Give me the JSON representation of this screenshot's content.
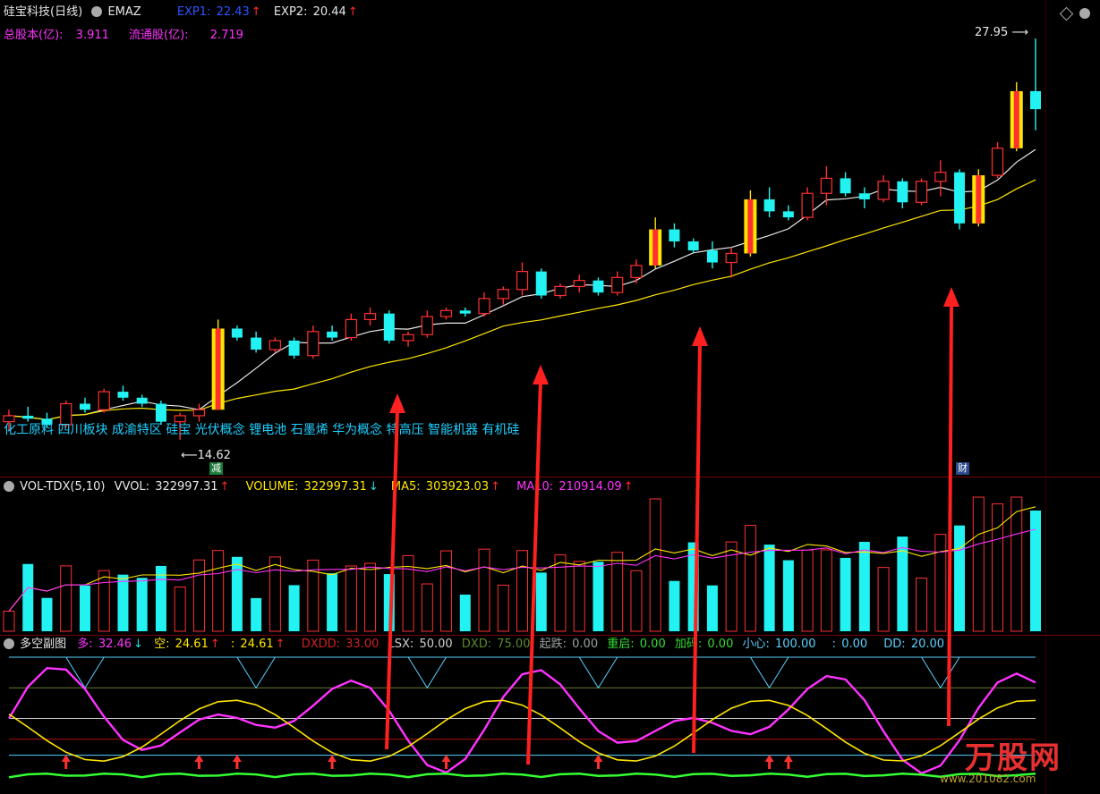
{
  "main_panel": {
    "stock_name": "硅宝科技(日线)",
    "indicator": "EMAZ",
    "exp1": {
      "label": "EXP1:",
      "value": "22.43",
      "arrow": "↑"
    },
    "exp2": {
      "label": "EXP2:",
      "value": "20.44",
      "arrow": "↑"
    },
    "total_share_label": "总股本(亿):",
    "total_share_value": "3.911",
    "float_share_label": "流通股(亿):",
    "float_share_value": "2.719",
    "high_label": "27.95",
    "low_label": "14.62",
    "concepts": "化工原料 四川板块 成渝特区 硅宝 光伏概念 锂电池 石墨烯 华为概念 特高压 智能机器 有机硅",
    "tag_jian": "减",
    "tag_cai": "财"
  },
  "volume_panel": {
    "name": "VOL-TDX(5,10)",
    "vvol": {
      "label": "VVOL:",
      "value": "322997.31",
      "arrow": "↑"
    },
    "volume": {
      "label": "VOLUME:",
      "value": "322997.31",
      "arrow": "↓"
    },
    "ma5": {
      "label": "MA5:",
      "value": "303923.03",
      "arrow": "↑"
    },
    "ma10": {
      "label": "MA10:",
      "value": "210914.09",
      "arrow": "↑"
    }
  },
  "sub_panel": {
    "name": "多空副图",
    "duo": {
      "label": "多:",
      "value": "32.46",
      "arrow": "↓"
    },
    "kong": {
      "label": "空:",
      "value": "24.61",
      "arrow": "↑"
    },
    "blank": {
      "label": ":",
      "value": "24.61",
      "arrow": "↑"
    },
    "dxdd": {
      "label": "DXDD:",
      "value": "33.00"
    },
    "lsx": {
      "label": "LSX:",
      "value": "50.00"
    },
    "dxd": {
      "label": "DXD:",
      "value": "75.00"
    },
    "qidie": {
      "label": "起跌:",
      "value": "0.00"
    },
    "chongqi": {
      "label": "重启:",
      "value": "0.00"
    },
    "jiama": {
      "label": "加码:",
      "value": "0.00"
    },
    "xiaoxin": {
      "label": "小心:",
      "value": "100.00"
    },
    "blank2": {
      "label": ":",
      "value": "0.00"
    },
    "dd": {
      "label": "DD:",
      "value": "20.00"
    }
  },
  "watermark": {
    "text": "万股网",
    "url": "www.201082.com"
  },
  "colors": {
    "up": "#ff3030",
    "down": "#22f2f2",
    "yellow": "#ffe600",
    "magenta": "#ff33ff",
    "white": "#e8e8e8",
    "green": "#33ff33"
  },
  "chart_data": {
    "type": "candlestick",
    "candles": [
      [
        15.2,
        15.6,
        14.9,
        15.4
      ],
      [
        15.4,
        15.7,
        15.2,
        15.3
      ],
      [
        15.3,
        15.5,
        15.0,
        15.1
      ],
      [
        15.1,
        15.9,
        15.0,
        15.8
      ],
      [
        15.8,
        16.0,
        15.5,
        15.6
      ],
      [
        15.6,
        16.3,
        15.5,
        16.2
      ],
      [
        16.2,
        16.4,
        15.9,
        16.0
      ],
      [
        16.0,
        16.1,
        15.7,
        15.8
      ],
      [
        15.8,
        15.9,
        15.1,
        15.2
      ],
      [
        15.2,
        15.5,
        14.6,
        15.4
      ],
      [
        15.4,
        15.8,
        15.2,
        15.6
      ],
      [
        15.6,
        18.6,
        15.6,
        18.3
      ],
      [
        18.3,
        18.4,
        17.9,
        18.0
      ],
      [
        18.0,
        18.2,
        17.5,
        17.6
      ],
      [
        17.6,
        18.0,
        17.5,
        17.9
      ],
      [
        17.9,
        18.0,
        17.3,
        17.4
      ],
      [
        17.4,
        18.4,
        17.3,
        18.2
      ],
      [
        18.2,
        18.4,
        17.9,
        18.0
      ],
      [
        18.0,
        18.8,
        17.9,
        18.6
      ],
      [
        18.6,
        19.0,
        18.4,
        18.8
      ],
      [
        18.8,
        18.9,
        17.8,
        17.9
      ],
      [
        17.9,
        18.2,
        17.7,
        18.1
      ],
      [
        18.1,
        18.9,
        18.0,
        18.7
      ],
      [
        18.7,
        19.0,
        18.6,
        18.9
      ],
      [
        18.9,
        19.0,
        18.7,
        18.8
      ],
      [
        18.8,
        19.5,
        18.7,
        19.3
      ],
      [
        19.3,
        19.7,
        19.1,
        19.6
      ],
      [
        19.6,
        20.5,
        19.4,
        20.2
      ],
      [
        20.2,
        20.3,
        19.3,
        19.4
      ],
      [
        19.4,
        19.8,
        19.3,
        19.7
      ],
      [
        19.7,
        20.1,
        19.5,
        19.9
      ],
      [
        19.9,
        20.0,
        19.4,
        19.5
      ],
      [
        19.5,
        20.2,
        19.4,
        20.0
      ],
      [
        20.0,
        20.6,
        19.8,
        20.4
      ],
      [
        20.4,
        22.0,
        20.3,
        21.6
      ],
      [
        21.6,
        21.8,
        21.0,
        21.2
      ],
      [
        21.2,
        21.3,
        20.8,
        20.9
      ],
      [
        20.9,
        21.2,
        20.3,
        20.5
      ],
      [
        20.5,
        21.0,
        20.0,
        20.8
      ],
      [
        20.8,
        22.9,
        20.7,
        22.6
      ],
      [
        22.6,
        23.0,
        22.0,
        22.2
      ],
      [
        22.2,
        22.4,
        21.9,
        22.0
      ],
      [
        22.0,
        23.0,
        21.9,
        22.8
      ],
      [
        22.8,
        23.7,
        22.4,
        23.3
      ],
      [
        23.3,
        23.5,
        22.7,
        22.8
      ],
      [
        22.8,
        23.0,
        22.3,
        22.6
      ],
      [
        22.6,
        23.4,
        22.5,
        23.2
      ],
      [
        23.2,
        23.3,
        22.3,
        22.5
      ],
      [
        22.5,
        23.3,
        22.4,
        23.2
      ],
      [
        23.2,
        23.9,
        22.7,
        23.5
      ],
      [
        23.5,
        23.6,
        21.6,
        21.8
      ],
      [
        21.8,
        23.6,
        21.7,
        23.4
      ],
      [
        23.4,
        24.5,
        23.3,
        24.3
      ],
      [
        24.3,
        26.5,
        24.2,
        26.2
      ],
      [
        26.2,
        27.95,
        24.9,
        25.6
      ]
    ],
    "highs_label": "27.95",
    "lows_label": "14.62"
  }
}
